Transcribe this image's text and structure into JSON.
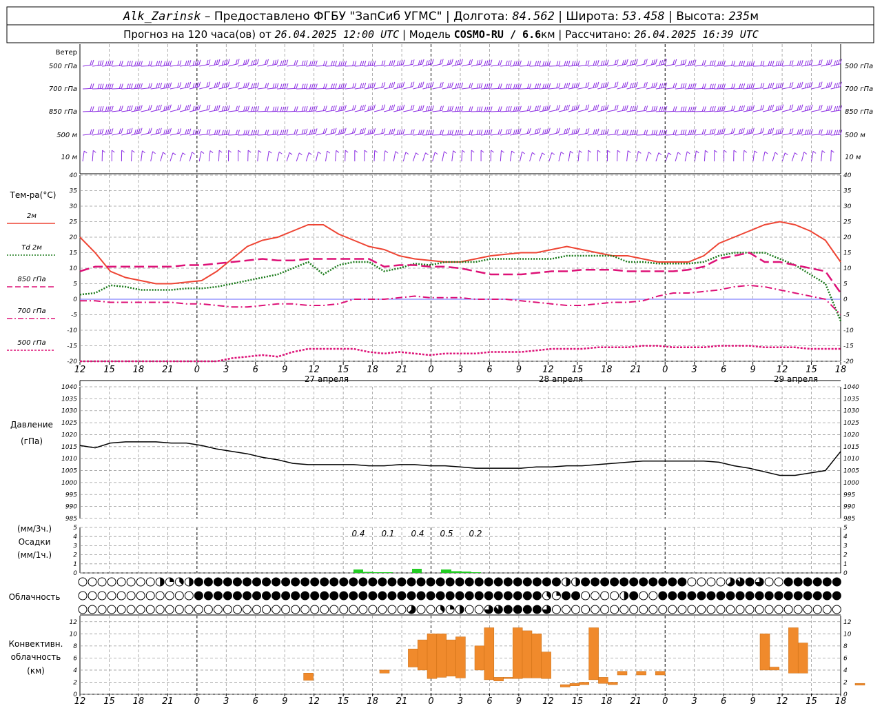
{
  "header": {
    "line1": [
      {
        "text": "Alk_Zarinsk",
        "style": "ital"
      },
      {
        "text": " – Предоставлено ФГБУ \"ЗапСиб УГМС\" | Долгота: ",
        "style": ""
      },
      {
        "text": "84.562",
        "style": "ital"
      },
      {
        "text": " | Широта: ",
        "style": ""
      },
      {
        "text": "53.458",
        "style": "ital"
      },
      {
        "text": " | Высота: ",
        "style": ""
      },
      {
        "text": "235",
        "style": "ital"
      },
      {
        "text": "м",
        "style": ""
      }
    ],
    "line2": [
      {
        "text": "Прогноз на 120 часа(ов) от ",
        "style": ""
      },
      {
        "text": "26.04.2025 12:00 UTC",
        "style": "ital"
      },
      {
        "text": "  | Модель ",
        "style": ""
      },
      {
        "text": "COSMO-RU / 6.6",
        "style": "bold"
      },
      {
        "text": "км | Рассчитано: ",
        "style": ""
      },
      {
        "text": "26.04.2025 16:39 UTC",
        "style": "ital"
      }
    ]
  },
  "time_axis": {
    "ticks": [
      "12",
      "15",
      "18",
      "21",
      "0",
      "3",
      "6",
      "9",
      "12",
      "15",
      "18",
      "21",
      "0",
      "3",
      "6",
      "9",
      "12",
      "15",
      "18",
      "21",
      "0",
      "3",
      "6",
      "9",
      "12",
      "15",
      "18"
    ],
    "day_labels": [
      "27 апреля",
      "28 апреля",
      "29 апреля"
    ]
  },
  "wind_panel": {
    "title": "Ветер",
    "levels": [
      "500 гПа",
      "700 гПа",
      "850 гПа",
      "500 м",
      "10  м"
    ],
    "color": "#8a2be2"
  },
  "temp_panel": {
    "title": "Тем-ра(°C)",
    "legend": [
      {
        "label": "2м",
        "color": "#ee4433",
        "dash": "solid"
      },
      {
        "label": "Td  2м",
        "color": "#1a7a1a",
        "dash": "dotted"
      },
      {
        "label": "850 гПа",
        "color": "#dd1177",
        "dash": "long"
      },
      {
        "label": "700 гПа",
        "color": "#dd1177",
        "dash": "dashdot"
      },
      {
        "label": "500 гПа",
        "color": "#dd1177",
        "dash": "dense"
      }
    ],
    "yticks": [
      "40",
      "35",
      "30",
      "25",
      "20",
      "15",
      "10",
      "5",
      "0",
      "-5",
      "-10",
      "-15",
      "-20"
    ]
  },
  "pressure_panel": {
    "title_line1": "Давление",
    "title_line2": "(гПа)",
    "yticks": [
      "1040",
      "1035",
      "1030",
      "1025",
      "1020",
      "1015",
      "1010",
      "1005",
      "1000",
      "995",
      "990",
      "985"
    ]
  },
  "precip_panel": {
    "title_line1": "(мм/3ч.)",
    "title_line2": "Осадки",
    "title_line3": "(мм/1ч.)",
    "yticks": [
      "5",
      "4",
      "3",
      "2",
      "1",
      "0"
    ],
    "labels": [
      "0.4",
      "0.1",
      "0.4",
      "0.5",
      "0.2"
    ]
  },
  "cloud_panel": {
    "title": "Облачность"
  },
  "conv_panel": {
    "title_line1": "Конвективн.",
    "title_line2": "облачность",
    "title_line3": "(км)",
    "yticks": [
      "12",
      "10",
      "8",
      "6",
      "4",
      "2",
      "0"
    ]
  },
  "chart_data": [
    {
      "type": "line",
      "title": "Тем-ра(°C)",
      "x_hours": [
        0,
        3,
        6,
        9,
        12,
        15,
        18,
        21,
        24,
        27,
        30,
        33,
        36,
        39,
        42,
        45,
        48,
        51,
        54,
        57,
        60,
        63,
        66,
        69,
        72,
        75,
        78,
        81,
        84,
        87,
        90,
        93,
        96,
        99,
        102,
        105,
        108,
        111,
        114,
        117,
        120,
        123,
        126,
        129,
        132,
        135,
        138,
        141,
        144,
        147,
        150
      ],
      "ylim": [
        -20,
        40
      ],
      "series": [
        {
          "name": "2м",
          "values": [
            20,
            15,
            9,
            7,
            6,
            5,
            5,
            5.5,
            6,
            9,
            13,
            17,
            19,
            20,
            22,
            24,
            24,
            21,
            19,
            17,
            16,
            14,
            13,
            12.5,
            12,
            12,
            13,
            14,
            14.5,
            15,
            15,
            16,
            17,
            16,
            15,
            14,
            14,
            13,
            12,
            12,
            12,
            14,
            18,
            20,
            22,
            24,
            25,
            24,
            22,
            19,
            12
          ]
        },
        {
          "name": "Td 2м",
          "values": [
            1.5,
            2,
            4.5,
            4,
            3,
            3,
            3,
            3.5,
            3.5,
            4,
            5,
            6,
            7,
            8,
            10,
            12,
            8,
            11,
            12,
            12,
            9,
            10,
            11.5,
            11,
            12,
            12,
            12,
            13,
            13,
            13,
            13,
            13,
            14,
            14,
            14,
            14,
            12,
            12,
            11.5,
            11.5,
            11.5,
            12,
            14,
            15,
            15,
            15,
            13,
            11,
            8,
            5,
            -7
          ]
        },
        {
          "name": "850 гПа",
          "values": [
            9,
            10.5,
            10.5,
            10.5,
            10.5,
            10.5,
            10.5,
            11,
            11,
            11.5,
            12,
            12.5,
            13,
            12.5,
            12.5,
            13,
            13,
            13,
            13,
            13,
            10.5,
            11,
            11,
            10.5,
            10.5,
            10,
            9,
            8,
            8,
            8,
            8.5,
            9,
            9,
            9.5,
            9.5,
            9.5,
            9,
            9,
            9,
            9,
            9.5,
            10.5,
            13,
            14,
            15,
            12,
            12,
            11,
            10,
            9,
            2
          ]
        },
        {
          "name": "700 гПа",
          "values": [
            -0.5,
            -0.5,
            -1,
            -1,
            -1,
            -1,
            -1,
            -1.5,
            -1.5,
            -2,
            -2.5,
            -2.5,
            -2,
            -1.5,
            -1.5,
            -2,
            -2,
            -1.5,
            0,
            0,
            0,
            0.5,
            1,
            0.5,
            0.5,
            0.5,
            0,
            0,
            0,
            -0.5,
            -1,
            -1.5,
            -2,
            -2,
            -1.5,
            -1,
            -1,
            -0.5,
            1,
            2,
            2,
            2.5,
            3,
            4,
            4.5,
            4,
            3,
            2,
            1,
            0,
            -5
          ]
        },
        {
          "name": "500 гПа",
          "values": [
            -20,
            -20,
            -22,
            -22,
            -22,
            -21,
            -21,
            -21,
            -20.5,
            -20,
            -19,
            -18.5,
            -18,
            -18.5,
            -17,
            -16,
            -16,
            -16,
            -16,
            -17,
            -17.5,
            -17,
            -17.5,
            -18,
            -17.5,
            -17.5,
            -17.5,
            -17,
            -17,
            -17,
            -16.5,
            -16,
            -16,
            -16,
            -15.5,
            -15.5,
            -15.5,
            -15,
            -15,
            -15.5,
            -15.5,
            -15.5,
            -15,
            -15,
            -15,
            -15.5,
            -15.5,
            -15.5,
            -16,
            -16,
            -16
          ]
        }
      ]
    },
    {
      "type": "line",
      "title": "Давление (гПа)",
      "x_hours": [
        0,
        3,
        6,
        9,
        12,
        15,
        18,
        21,
        24,
        27,
        30,
        33,
        36,
        39,
        42,
        45,
        48,
        51,
        54,
        57,
        60,
        63,
        66,
        69,
        72,
        75,
        78,
        81,
        84,
        87,
        90,
        93,
        96,
        99,
        102,
        105,
        108,
        111,
        114,
        117,
        120,
        123,
        126,
        129,
        132,
        135,
        138,
        141,
        144,
        147,
        150
      ],
      "ylim": [
        985,
        1040
      ],
      "series": [
        {
          "name": "Давление",
          "values": [
            1015.5,
            1014.5,
            1016.5,
            1017,
            1017,
            1017,
            1016.5,
            1016.5,
            1015.5,
            1014,
            1013,
            1012,
            1010.5,
            1009.5,
            1008,
            1007.5,
            1007.5,
            1007.5,
            1007.5,
            1007,
            1007,
            1007.5,
            1007.5,
            1007,
            1007,
            1006.5,
            1006,
            1006,
            1006,
            1006,
            1006.5,
            1006.5,
            1007,
            1007,
            1007.5,
            1008,
            1008.5,
            1009,
            1009,
            1009,
            1009,
            1009,
            1008.5,
            1007,
            1006,
            1004.5,
            1003,
            1003,
            1004,
            1005,
            1013
          ]
        }
      ]
    },
    {
      "type": "bar",
      "title": "Осадки",
      "x_hours": [
        48,
        51,
        54,
        57,
        60,
        63,
        66,
        69
      ],
      "ylim": [
        0,
        5
      ],
      "series": [
        {
          "name": "мм/1ч.",
          "values": [
            0.5,
            0.15,
            0.1,
            0,
            0.5,
            0.05,
            0.5,
            0.2
          ]
        }
      ]
    },
    {
      "type": "bar",
      "title": "Конвективн. облачность (км)",
      "ylim": [
        0,
        12
      ],
      "bars": [
        {
          "h": 37,
          "bottom": 2.3,
          "top": 3.5
        },
        {
          "h": 45,
          "bottom": 3.5,
          "top": 4
        },
        {
          "h": 48,
          "bottom": 4.5,
          "top": 7.5
        },
        {
          "h": 49,
          "bottom": 4,
          "top": 9
        },
        {
          "h": 50,
          "bottom": 2.6,
          "top": 10
        },
        {
          "h": 51,
          "bottom": 2.8,
          "top": 10
        },
        {
          "h": 52,
          "bottom": 3,
          "top": 9
        },
        {
          "h": 53,
          "bottom": 2.7,
          "top": 9.5
        },
        {
          "h": 55,
          "bottom": 4,
          "top": 8
        },
        {
          "h": 56,
          "bottom": 2.4,
          "top": 11
        },
        {
          "h": 57,
          "bottom": 2.2,
          "top": 2.8
        },
        {
          "h": 58,
          "bottom": 2.6,
          "top": 2.8
        },
        {
          "h": 59,
          "bottom": 2.6,
          "top": 11
        },
        {
          "h": 60,
          "bottom": 2.7,
          "top": 10.5
        },
        {
          "h": 61,
          "bottom": 2.7,
          "top": 10
        },
        {
          "h": 62,
          "bottom": 2.6,
          "top": 7
        },
        {
          "h": 64,
          "bottom": 1.2,
          "top": 1.6
        },
        {
          "h": 65,
          "bottom": 1.4,
          "top": 1.8
        },
        {
          "h": 66,
          "bottom": 1.6,
          "top": 2
        },
        {
          "h": 67,
          "bottom": 2.4,
          "top": 11
        },
        {
          "h": 68,
          "bottom": 1.8,
          "top": 2.8
        },
        {
          "h": 69,
          "bottom": 1.6,
          "top": 2
        },
        {
          "h": 70,
          "bottom": 3.2,
          "top": 3.8
        },
        {
          "h": 72,
          "bottom": 3.2,
          "top": 3.8
        },
        {
          "h": 74,
          "bottom": 3.2,
          "top": 3.8
        },
        {
          "h": 85,
          "bottom": 4,
          "top": 10
        },
        {
          "h": 86,
          "bottom": 4,
          "top": 4.5
        },
        {
          "h": 88,
          "bottom": 3.5,
          "top": 11
        },
        {
          "h": 89,
          "bottom": 3.5,
          "top": 8.5
        },
        {
          "h": 95,
          "bottom": 1.5,
          "top": 1.8
        },
        {
          "h": 98,
          "bottom": 1.8,
          "top": 2.2
        },
        {
          "h": 104,
          "bottom": 4.5,
          "top": 6.3
        },
        {
          "h": 105,
          "bottom": 4.2,
          "top": 6.3
        },
        {
          "h": 106,
          "bottom": 3.8,
          "top": 5
        }
      ]
    }
  ]
}
